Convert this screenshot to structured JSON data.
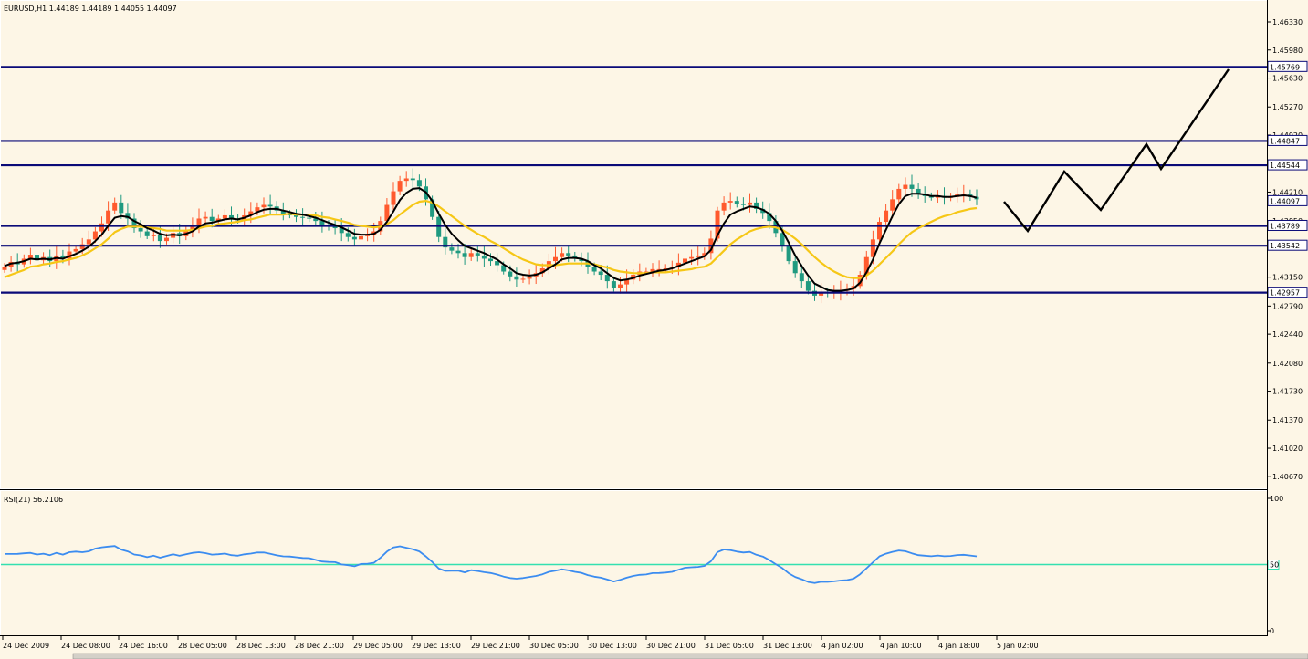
{
  "window": {
    "symbol_line": "EURUSD,H1  1.44189 1.44189 1.44055 1.44097",
    "rsi_label": "RSI(21) 56.2106"
  },
  "colors": {
    "background": "#fdf6e6",
    "bull_candle": "#ff5a2e",
    "bear_candle": "#209a80",
    "fast_ma": "#000000",
    "slow_ma": "#f6c716",
    "level_line": "#0a0a78",
    "rsi_line": "#3b8cf0",
    "rsi_level": "#33e0b0",
    "projection": "#000000"
  },
  "chart_data": [
    {
      "type": "candlestick",
      "symbol": "EURUSD",
      "timeframe": "H1",
      "ylim": [
        1.4052,
        1.4658
      ],
      "y_ticks": [
        "1.46330",
        "1.45980",
        "1.45630",
        "1.45270",
        "1.44920",
        "1.44210",
        "1.43850",
        "1.43150",
        "1.42790",
        "1.42440",
        "1.42080",
        "1.41730",
        "1.41370",
        "1.41020",
        "1.40670"
      ],
      "x_ticks": [
        "24 Dec 2009",
        "24 Dec 08:00",
        "24 Dec 16:00",
        "28 Dec 05:00",
        "28 Dec 13:00",
        "28 Dec 21:00",
        "29 Dec 05:00",
        "29 Dec 13:00",
        "29 Dec 21:00",
        "30 Dec 05:00",
        "30 Dec 13:00",
        "30 Dec 21:00",
        "31 Dec 05:00",
        "31 Dec 13:00",
        "4 Jan 02:00",
        "4 Jan 10:00",
        "4 Jan 18:00",
        "5 Jan 02:00"
      ],
      "horizontal_levels": [
        {
          "value": 1.45769,
          "label": "1.45769"
        },
        {
          "value": 1.44847,
          "label": "1.44847"
        },
        {
          "value": 1.44544,
          "label": "1.44544"
        },
        {
          "value": 1.43789,
          "label": "1.43789"
        },
        {
          "value": 1.43542,
          "label": "1.43542"
        },
        {
          "value": 1.42957,
          "label": "1.42957"
        }
      ],
      "current_price": {
        "value": 1.44097,
        "label": "1.44097"
      },
      "closes": [
        1.4328,
        1.4334,
        1.4331,
        1.4338,
        1.4343,
        1.4336,
        1.434,
        1.4335,
        1.4342,
        1.4338,
        1.4347,
        1.435,
        1.4356,
        1.4362,
        1.4372,
        1.4382,
        1.4398,
        1.4408,
        1.4395,
        1.4388,
        1.4376,
        1.4372,
        1.4366,
        1.4368,
        1.436,
        1.4364,
        1.437,
        1.4366,
        1.4372,
        1.438,
        1.4388,
        1.439,
        1.4385,
        1.4388,
        1.4392,
        1.4388,
        1.4386,
        1.4392,
        1.4397,
        1.4402,
        1.4405,
        1.4403,
        1.4398,
        1.4394,
        1.4392,
        1.439,
        1.4389,
        1.4388,
        1.4385,
        1.438,
        1.4378,
        1.4376,
        1.437,
        1.4365,
        1.4362,
        1.4366,
        1.4368,
        1.4372,
        1.4385,
        1.4405,
        1.4422,
        1.4435,
        1.4438,
        1.4436,
        1.4428,
        1.4412,
        1.439,
        1.4365,
        1.4352,
        1.4348,
        1.4345,
        1.434,
        1.4345,
        1.4342,
        1.4338,
        1.4335,
        1.433,
        1.4322,
        1.4316,
        1.4312,
        1.4313,
        1.4316,
        1.432,
        1.4326,
        1.4335,
        1.434,
        1.4345,
        1.4342,
        1.4338,
        1.4335,
        1.4328,
        1.4322,
        1.4318,
        1.431,
        1.4302,
        1.4306,
        1.4312,
        1.4318,
        1.4322,
        1.4322,
        1.4325,
        1.4325,
        1.4326,
        1.4327,
        1.4333,
        1.4338,
        1.434,
        1.4342,
        1.4345,
        1.4363,
        1.4398,
        1.4408,
        1.441,
        1.4406,
        1.4405,
        1.4408,
        1.44,
        1.4395,
        1.4385,
        1.437,
        1.4355,
        1.4335,
        1.432,
        1.431,
        1.4298,
        1.4292,
        1.4296,
        1.4295,
        1.4296,
        1.4298,
        1.43,
        1.4304,
        1.4318,
        1.434,
        1.4362,
        1.4384,
        1.4398,
        1.4412,
        1.4425,
        1.443,
        1.4425,
        1.4418,
        1.4416,
        1.4414,
        1.4416,
        1.4414,
        1.4415,
        1.4418,
        1.4418,
        1.4415,
        1.4412
      ],
      "fast_ma": [
        1.4329,
        1.4332,
        1.4333,
        1.4335,
        1.4338,
        1.4337,
        1.4338,
        1.4337,
        1.4339,
        1.4338,
        1.4341,
        1.4344,
        1.4348,
        1.4353,
        1.436,
        1.4368,
        1.4379,
        1.4389,
        1.4391,
        1.439,
        1.4385,
        1.4381,
        1.4376,
        1.4373,
        1.4369,
        1.4367,
        1.4368,
        1.4367,
        1.4369,
        1.4372,
        1.4378,
        1.4382,
        1.4383,
        1.4385,
        1.4387,
        1.4388,
        1.4387,
        1.4389,
        1.4392,
        1.4396,
        1.4399,
        1.44,
        1.44,
        1.4398,
        1.4396,
        1.4394,
        1.4393,
        1.4391,
        1.4389,
        1.4386,
        1.4383,
        1.438,
        1.4377,
        1.4373,
        1.4369,
        1.4368,
        1.4368,
        1.4369,
        1.4374,
        1.4384,
        1.4397,
        1.4411,
        1.442,
        1.4425,
        1.4426,
        1.4421,
        1.441,
        1.4394,
        1.438,
        1.4369,
        1.4361,
        1.4354,
        1.4351,
        1.4348,
        1.4345,
        1.4341,
        1.4337,
        1.4331,
        1.4326,
        1.432,
        1.4318,
        1.4317,
        1.4318,
        1.4321,
        1.4326,
        1.4331,
        1.4337,
        1.4339,
        1.4339,
        1.4338,
        1.4335,
        1.433,
        1.4326,
        1.432,
        1.4314,
        1.4311,
        1.4312,
        1.4314,
        1.4317,
        1.4319,
        1.4321,
        1.4323,
        1.4324,
        1.4326,
        1.4329,
        1.4332,
        1.4335,
        1.4338,
        1.4341,
        1.4349,
        1.4367,
        1.4382,
        1.4393,
        1.4397,
        1.44,
        1.4403,
        1.4402,
        1.4399,
        1.4394,
        1.4385,
        1.4373,
        1.4358,
        1.4342,
        1.4329,
        1.4317,
        1.4307,
        1.4303,
        1.4299,
        1.4298,
        1.4298,
        1.4299,
        1.4301,
        1.4308,
        1.4321,
        1.4337,
        1.4357,
        1.4374,
        1.4391,
        1.4406,
        1.4416,
        1.4419,
        1.4419,
        1.4418,
        1.4416,
        1.4416,
        1.4415,
        1.4415,
        1.4416,
        1.4417,
        1.4416,
        1.4414
      ],
      "slow_ma": [
        1.4315,
        1.4318,
        1.4321,
        1.4324,
        1.4328,
        1.4329,
        1.4331,
        1.4332,
        1.4334,
        1.4335,
        1.4337,
        1.4339,
        1.4342,
        1.4346,
        1.4351,
        1.4356,
        1.4363,
        1.4371,
        1.4375,
        1.4378,
        1.4378,
        1.4378,
        1.4377,
        1.4376,
        1.4375,
        1.4373,
        1.4373,
        1.4373,
        1.4373,
        1.4374,
        1.4376,
        1.4378,
        1.4379,
        1.4381,
        1.4382,
        1.4383,
        1.4384,
        1.4386,
        1.4387,
        1.4389,
        1.4391,
        1.4393,
        1.4393,
        1.4393,
        1.4394,
        1.4393,
        1.4393,
        1.4392,
        1.4392,
        1.439,
        1.4389,
        1.4387,
        1.4385,
        1.4383,
        1.438,
        1.4379,
        1.4378,
        1.4377,
        1.4378,
        1.4381,
        1.4386,
        1.4393,
        1.4399,
        1.4405,
        1.4409,
        1.441,
        1.4408,
        1.4403,
        1.4397,
        1.4391,
        1.4385,
        1.4379,
        1.4374,
        1.4369,
        1.4365,
        1.436,
        1.4356,
        1.4351,
        1.4346,
        1.4341,
        1.4337,
        1.4334,
        1.4331,
        1.433,
        1.433,
        1.433,
        1.4331,
        1.4332,
        1.4332,
        1.4332,
        1.4332,
        1.4331,
        1.4329,
        1.4327,
        1.4324,
        1.4322,
        1.4321,
        1.432,
        1.432,
        1.432,
        1.4321,
        1.4321,
        1.4321,
        1.4322,
        1.4323,
        1.4324,
        1.4325,
        1.4327,
        1.4328,
        1.4332,
        1.434,
        1.4348,
        1.4356,
        1.4362,
        1.4367,
        1.4372,
        1.4375,
        1.4377,
        1.4378,
        1.4377,
        1.4374,
        1.4369,
        1.4363,
        1.4356,
        1.4348,
        1.434,
        1.4333,
        1.4327,
        1.4322,
        1.4318,
        1.4315,
        1.4314,
        1.4314,
        1.4317,
        1.4323,
        1.4331,
        1.4339,
        1.4347,
        1.4356,
        1.4364,
        1.4371,
        1.4376,
        1.438,
        1.4384,
        1.4388,
        1.4391,
        1.4393,
        1.4396,
        1.4398,
        1.44,
        1.4401
      ]
    },
    {
      "type": "line",
      "indicator": "RSI",
      "period": 21,
      "last_value": 56.2106,
      "ylim": [
        0,
        100
      ],
      "levels": [
        50
      ],
      "y_ticks": [
        "100",
        "50",
        "0"
      ],
      "values": [
        58,
        58,
        58.1,
        58.5,
        58.8,
        57.6,
        58.2,
        57.1,
        58.8,
        57.5,
        59.3,
        59.8,
        59.3,
        60,
        62.1,
        63,
        63.6,
        64,
        61.3,
        59.9,
        57.6,
        56.9,
        55.6,
        56.7,
        55.2,
        56.5,
        57.7,
        56.6,
        57.7,
        58.8,
        59.3,
        58.6,
        57.5,
        57.8,
        58.3,
        57.1,
        56.7,
        57.7,
        58.3,
        59.1,
        59.1,
        58.1,
        57,
        56.2,
        56.1,
        55.5,
        55,
        54.8,
        53.5,
        52.3,
        51.9,
        51.8,
        50.1,
        49.5,
        48.7,
        50.4,
        50.6,
        51.3,
        55.1,
        59.8,
        62.9,
        63.8,
        62.7,
        61.5,
        59.9,
        56.2,
        51.9,
        47,
        45.2,
        45.3,
        45.4,
        44.1,
        45.7,
        45.1,
        44.2,
        43.6,
        42.4,
        40.9,
        39.8,
        39.3,
        39.8,
        40.6,
        41.4,
        42.6,
        44.5,
        45.4,
        46.4,
        45.6,
        44.5,
        43.7,
        42,
        40.8,
        40.1,
        38.7,
        37.2,
        38.5,
        40.1,
        41.4,
        42.2,
        42.5,
        43.5,
        43.6,
        43.9,
        44.5,
        46.1,
        47.6,
        47.9,
        48.2,
        49,
        52.5,
        59.4,
        61.4,
        60.9,
        59.8,
        59.1,
        59.5,
        57.4,
        56.1,
        53.4,
        50.3,
        47.3,
        43.4,
        40.6,
        38.9,
        36.8,
        36,
        37,
        36.9,
        37.3,
        37.9,
        38.3,
        39.3,
        42.6,
        47.2,
        51.7,
        56.2,
        58.2,
        59.6,
        60.6,
        60.1,
        58.5,
        57.1,
        56.7,
        56.3,
        56.8,
        56.3,
        56.5,
        57.2,
        57.4,
        56.8,
        56.2
      ]
    }
  ]
}
